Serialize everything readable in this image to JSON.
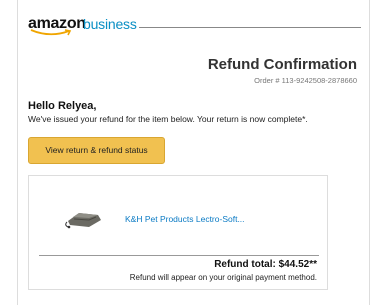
{
  "logo": {
    "word1": "amazon",
    "word2": "business",
    "business_color": "#0a8fc4"
  },
  "header": {
    "title": "Refund Confirmation",
    "order_number": "Order # 113-9242508-2878660"
  },
  "body": {
    "greeting": "Hello Relyea,",
    "message": "We've issued your refund for the item below. Your return is now complete*.",
    "button_label": "View return & refund status",
    "button_color": "#f1c150"
  },
  "item": {
    "name": "K&H Pet Products Lectro-Soft...",
    "image": "pet-bed-product-image",
    "link_color": "#0a7ac4"
  },
  "refund": {
    "total": "Refund total: $44.52**",
    "note": "Refund will appear on your original payment method."
  }
}
